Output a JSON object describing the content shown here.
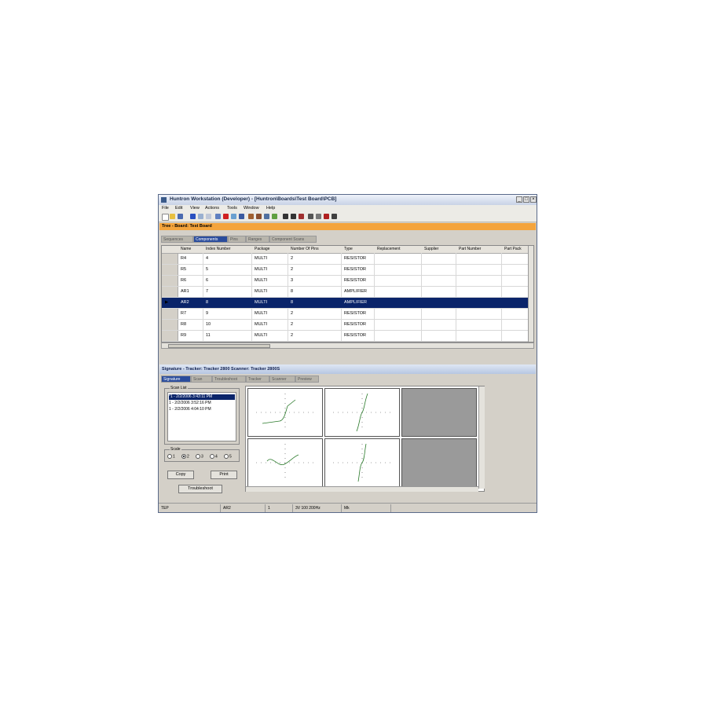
{
  "window": {
    "title": "Huntron Workstation (Developer) - [Huntron\\Boards\\Test Board\\PCB]"
  },
  "menu": [
    "File",
    "Edit",
    "View",
    "Actions",
    "Tools",
    "Window",
    "Help"
  ],
  "tree_bar": {
    "title": "Tree - Board: Test Board"
  },
  "top_tabs": [
    "Sequences",
    "Components",
    "Pins",
    "Ranges",
    "Component Scans"
  ],
  "grid": {
    "columns": [
      "Name",
      "Index Number",
      "Package",
      "Number Of Pins",
      "Type",
      "Replacement",
      "Supplier",
      "Part Number",
      "Part Pack"
    ],
    "rows": [
      {
        "name": "R4",
        "index": "4",
        "package": "MULTI",
        "pins": "2",
        "type": "RESISTOR"
      },
      {
        "name": "R5",
        "index": "5",
        "package": "MULTI",
        "pins": "2",
        "type": "RESISTOR"
      },
      {
        "name": "R6",
        "index": "6",
        "package": "MULTI",
        "pins": "3",
        "type": "RESISTOR"
      },
      {
        "name": "AR1",
        "index": "7",
        "package": "MULTI",
        "pins": "8",
        "type": "AMPLIFIER"
      },
      {
        "name": "AR2",
        "index": "8",
        "package": "MULTI",
        "pins": "8",
        "type": "AMPLIFIER"
      },
      {
        "name": "R7",
        "index": "9",
        "package": "MULTI",
        "pins": "2",
        "type": "RESISTOR"
      },
      {
        "name": "R8",
        "index": "10",
        "package": "MULTI",
        "pins": "2",
        "type": "RESISTOR"
      },
      {
        "name": "R9",
        "index": "11",
        "package": "MULTI",
        "pins": "2",
        "type": "RESISTOR"
      }
    ],
    "selected_row": 4
  },
  "signature_bar": {
    "title": "Signature - Tracker: Tracker 2800 Scanner: Tracker 2800S"
  },
  "bottom_tabs": [
    "Signature",
    "Scan",
    "Troubleshoot",
    "Tracker",
    "Scanner",
    "Preview"
  ],
  "scan_list": {
    "legend": "Scan List",
    "items": [
      "*1 - 2/2/2006 3:43:11 PM",
      "1 - 2/2/2006 3:52:16 PM",
      "1 - 2/2/2006 4:04:10 PM"
    ],
    "selected": 0
  },
  "scale": {
    "legend": "Scale",
    "options": [
      "1",
      "2",
      "3",
      "4",
      "5"
    ],
    "selected": "2"
  },
  "buttons": {
    "copy": "Copy",
    "print": "Print",
    "troubleshoot": "Troubleshoot"
  },
  "status": [
    "TEP",
    "AR2",
    "1",
    "3V 100 200Hz",
    "Mk"
  ],
  "colors": {
    "tree_bar": "#f4a43c",
    "selection": "#0a246a",
    "active_tab": "#2a4c9c",
    "trace": "#2a7a2a"
  }
}
